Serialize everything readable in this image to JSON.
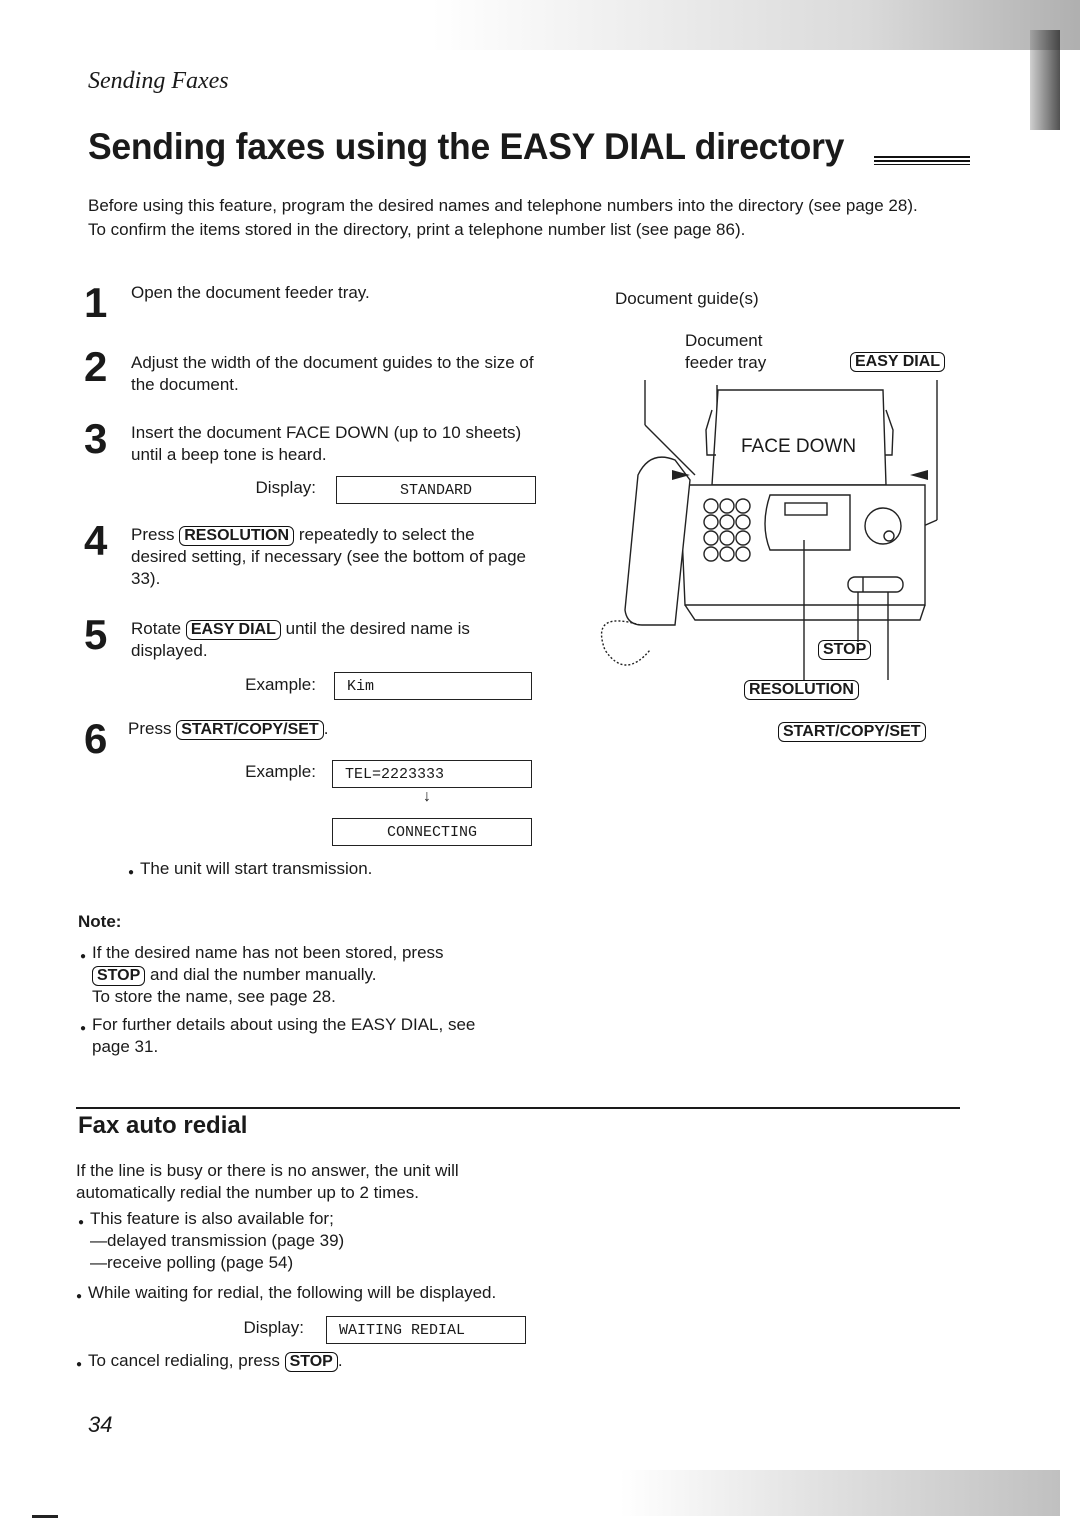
{
  "header": {
    "section": "Sending Faxes",
    "title": "Sending faxes using the EASY DIAL directory"
  },
  "intro": {
    "line1": "Before using this feature, program the desired names and telephone numbers into the directory (see page 28).",
    "line2": "To confirm the items stored in the directory, print a telephone number list (see page 86)."
  },
  "steps": [
    {
      "num": "1",
      "text": "Open the document feeder tray."
    },
    {
      "num": "2",
      "text": "Adjust the width of the document guides to the size of the document."
    },
    {
      "num": "3",
      "text": "Insert the document FACE DOWN (up to 10 sheets) until a beep tone is heard.",
      "display_label": "Display:",
      "display_value": "STANDARD"
    },
    {
      "num": "4",
      "before": "Press",
      "key": "RESOLUTION",
      "after": "repeatedly to select the desired setting, if necessary (see the bottom of page 33)."
    },
    {
      "num": "5",
      "before": "Rotate",
      "key": "EASY DIAL",
      "after": "until the desired name is displayed.",
      "display_label": "Example:",
      "display_value": "Kim"
    },
    {
      "num": "6",
      "before": "Press",
      "key": "START/COPY/SET",
      "after": ".",
      "display_label": "Example:",
      "display_value": "TEL=2223333",
      "display_value2": "CONNECTING",
      "bullet": "The unit will start transmission."
    }
  ],
  "arrow_down": "↓",
  "note": {
    "title": "Note:",
    "item1_before": "If the desired name has not been stored, press",
    "item1_key": "STOP",
    "item1_after": "and dial the number manually.",
    "item1_extra": "To store the name, see page 28.",
    "item2": "For further details about using the EASY DIAL, see page 31."
  },
  "diagram": {
    "label_guides": "Document guide(s)",
    "label_tray_1": "Document",
    "label_tray_2": "feeder tray",
    "label_face_down": "FACE DOWN",
    "key_easy_dial": "EASY DIAL",
    "key_stop": "STOP",
    "key_resolution": "RESOLUTION",
    "key_start": "START/COPY/SET"
  },
  "redial": {
    "heading": "Fax auto redial",
    "para": "If the line is busy or there is no answer, the unit will automatically redial the number up to 2 times.",
    "bullet1": "This feature is also available for;",
    "sub1": "—delayed transmission (page 39)",
    "sub2": "—receive polling (page 54)",
    "bullet2": "While waiting for redial, the following will be displayed.",
    "display_label": "Display:",
    "display_value": "WAITING REDIAL",
    "bullet3_before": "To cancel redialing, press",
    "bullet3_key": "STOP",
    "bullet3_after": "."
  },
  "footer": {
    "page_number": "34"
  }
}
